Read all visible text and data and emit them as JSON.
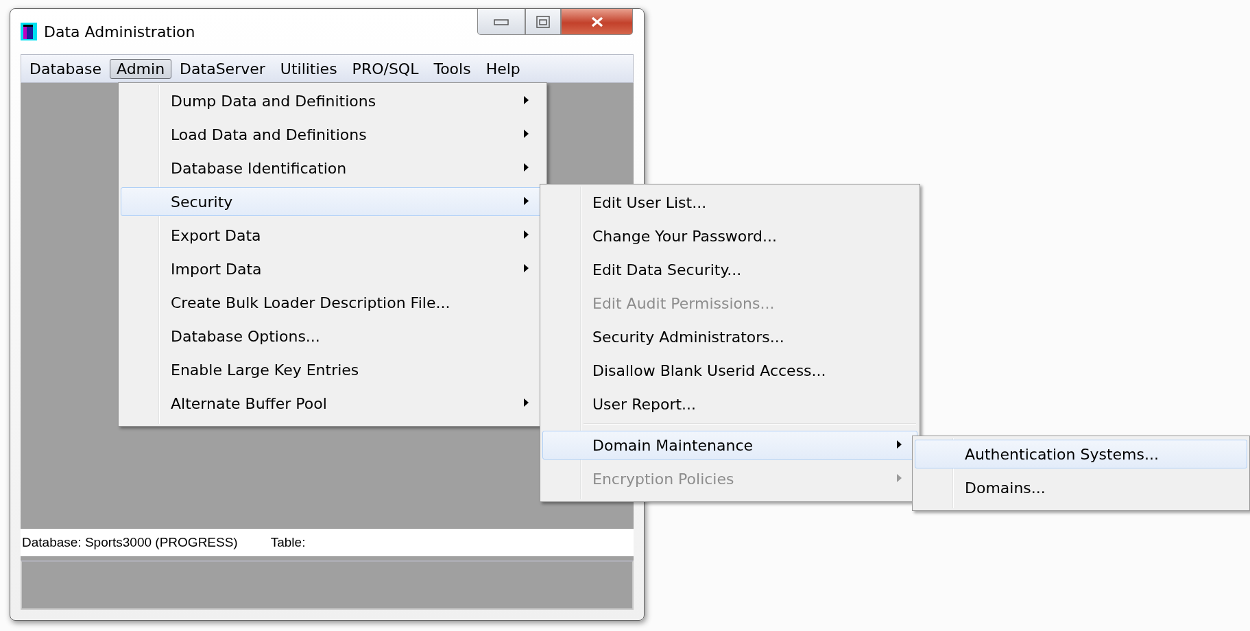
{
  "window": {
    "title": "Data Administration"
  },
  "menubar": [
    {
      "label": "Database",
      "selected": false
    },
    {
      "label": "Admin",
      "selected": true
    },
    {
      "label": "DataServer",
      "selected": false
    },
    {
      "label": "Utilities",
      "selected": false
    },
    {
      "label": "PRO/SQL",
      "selected": false
    },
    {
      "label": "Tools",
      "selected": false
    },
    {
      "label": "Help",
      "selected": false
    }
  ],
  "menus": [
    {
      "items": [
        {
          "kind": "submenu",
          "label": "Dump Data and Definitions",
          "disabled": false,
          "selected": false
        },
        {
          "kind": "submenu",
          "label": "Load Data and Definitions",
          "disabled": false,
          "selected": false
        },
        {
          "kind": "submenu",
          "label": "Database Identification",
          "disabled": false,
          "selected": false
        },
        {
          "kind": "submenu",
          "label": "Security",
          "disabled": false,
          "selected": true
        },
        {
          "kind": "submenu",
          "label": "Export Data",
          "disabled": false,
          "selected": false
        },
        {
          "kind": "submenu",
          "label": "Import Data",
          "disabled": false,
          "selected": false
        },
        {
          "kind": "item",
          "label": "Create Bulk Loader Description File...",
          "disabled": false,
          "selected": false
        },
        {
          "kind": "item",
          "label": "Database Options...",
          "disabled": false,
          "selected": false
        },
        {
          "kind": "item",
          "label": "Enable Large Key Entries",
          "disabled": false,
          "selected": false
        },
        {
          "kind": "submenu",
          "label": "Alternate Buffer Pool",
          "disabled": false,
          "selected": false
        }
      ]
    },
    {
      "items": [
        {
          "kind": "item",
          "label": "Edit User List...",
          "disabled": false,
          "selected": false
        },
        {
          "kind": "item",
          "label": "Change Your Password...",
          "disabled": false,
          "selected": false
        },
        {
          "kind": "item",
          "label": "Edit Data Security...",
          "disabled": false,
          "selected": false
        },
        {
          "kind": "item",
          "label": "Edit Audit Permissions...",
          "disabled": true,
          "selected": false
        },
        {
          "kind": "item",
          "label": "Security Administrators...",
          "disabled": false,
          "selected": false
        },
        {
          "kind": "item",
          "label": "Disallow Blank Userid Access...",
          "disabled": false,
          "selected": false
        },
        {
          "kind": "item",
          "label": "User Report...",
          "disabled": false,
          "selected": false
        },
        {
          "kind": "separator"
        },
        {
          "kind": "submenu",
          "label": "Domain Maintenance",
          "disabled": false,
          "selected": true
        },
        {
          "kind": "submenu",
          "label": "Encryption Policies",
          "disabled": true,
          "selected": false
        }
      ]
    },
    {
      "items": [
        {
          "kind": "item",
          "label": "Authentication Systems...",
          "disabled": false,
          "selected": true
        },
        {
          "kind": "item",
          "label": "Domains...",
          "disabled": false,
          "selected": false
        }
      ]
    }
  ],
  "status_bar": {
    "database": "Database: Sports3000 (PROGRESS)",
    "table": "Table:"
  }
}
